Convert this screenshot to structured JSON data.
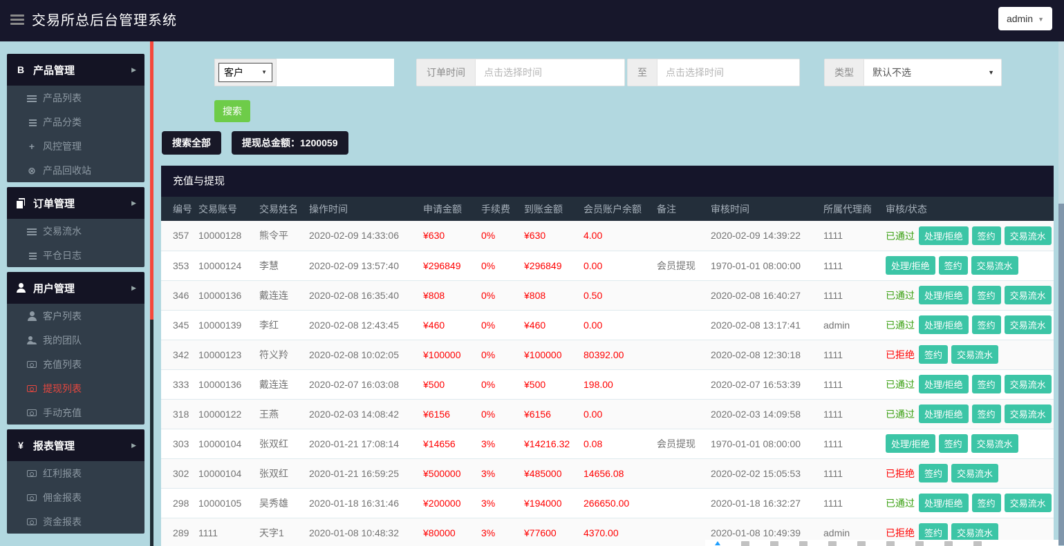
{
  "colors": {
    "header_bg": "#17172b",
    "panel_dark_bg": "#141424",
    "submenu_bg": "#313d49",
    "content_bg": "#b2d8e0",
    "sidebar_scroll_red": "#f5483b",
    "active_item_red": "#e8473f",
    "amount_red": "#ff0000",
    "pass_green": "#3aa012",
    "badge_teal": "#3cc5a6",
    "search_button_green": "#6ecc49",
    "table_header_bg": "#232e3a"
  },
  "header": {
    "title": "交易所总后台管理系统",
    "user_menu": "admin"
  },
  "sidebar": {
    "sections": [
      {
        "id": "product-management",
        "label": "产品管理",
        "icon": "bitcoin-icon",
        "items": [
          {
            "id": "product-list",
            "label": "产品列表",
            "icon": "list-icon",
            "active": false
          },
          {
            "id": "product-category",
            "label": "产品分类",
            "icon": "indent-list-icon",
            "active": false
          },
          {
            "id": "risk-control",
            "label": "风控管理",
            "icon": "move-icon",
            "active": false
          },
          {
            "id": "product-recycle",
            "label": "产品回收站",
            "icon": "cancel-circle-icon",
            "active": false
          }
        ]
      },
      {
        "id": "order-management",
        "label": "订单管理",
        "icon": "files-icon",
        "items": [
          {
            "id": "trade-flow",
            "label": "交易流水",
            "icon": "list-icon",
            "active": false
          },
          {
            "id": "close-log",
            "label": "平仓日志",
            "icon": "indent-list-icon",
            "active": false
          }
        ]
      },
      {
        "id": "user-management",
        "label": "用户管理",
        "icon": "user-icon",
        "items": [
          {
            "id": "customer-list",
            "label": "客户列表",
            "icon": "user-icon",
            "active": false
          },
          {
            "id": "my-team",
            "label": "我的团队",
            "icon": "team-icon",
            "active": false
          },
          {
            "id": "recharge-list",
            "label": "充值列表",
            "icon": "money-icon",
            "active": false
          },
          {
            "id": "withdraw-list",
            "label": "提现列表",
            "icon": "money-icon",
            "active": true
          },
          {
            "id": "manual-recharge",
            "label": "手动充值",
            "icon": "money-icon",
            "active": false
          }
        ]
      },
      {
        "id": "report-management",
        "label": "报表管理",
        "icon": "yen-icon",
        "items": [
          {
            "id": "bonus-report",
            "label": "红利报表",
            "icon": "money-icon",
            "active": false
          },
          {
            "id": "commission-report",
            "label": "佣金报表",
            "icon": "money-icon",
            "active": false
          },
          {
            "id": "fund-report",
            "label": "资金报表",
            "icon": "money-icon",
            "active": false
          }
        ]
      }
    ]
  },
  "filters": {
    "field_select": {
      "value": "客户"
    },
    "keyword_input": {
      "value": "",
      "placeholder": ""
    },
    "order_time_label": "订单时间",
    "date_from": {
      "value": "",
      "placeholder": "点击选择时间"
    },
    "to_label": "至",
    "date_to": {
      "value": "",
      "placeholder": "点击选择时间"
    },
    "type_label": "类型",
    "type_select": {
      "value": "默认不选"
    },
    "search_button": "搜索",
    "search_all_button": "搜索全部",
    "total_label": "提现总金额：1200059"
  },
  "table": {
    "title": "充值与提现",
    "columns": [
      "编号",
      "交易账号",
      "交易姓名",
      "操作时间",
      "申请金额",
      "手续费",
      "到账金额",
      "会员账户余额",
      "备注",
      "审核时间",
      "所属代理商",
      "审核/状态"
    ],
    "status_labels": {
      "pass": "已通过",
      "reject": "已拒绝"
    },
    "action_labels": {
      "handle": "处理/拒绝",
      "sign": "签约",
      "flow": "交易流水"
    },
    "rows": [
      {
        "id": "357",
        "account": "10000128",
        "name": "熊令平",
        "op_time": "2020-02-09 14:33:06",
        "apply": "¥630",
        "fee": "0%",
        "arrive": "¥630",
        "balance": "4.00",
        "remark": "",
        "audit_time": "2020-02-09 14:39:22",
        "agent": "1111",
        "status": "pass",
        "actions": [
          "handle",
          "sign",
          "flow"
        ]
      },
      {
        "id": "353",
        "account": "10000124",
        "name": "李慧",
        "op_time": "2020-02-09 13:57:40",
        "apply": "¥296849",
        "fee": "0%",
        "arrive": "¥296849",
        "balance": "0.00",
        "remark": "会员提现",
        "audit_time": "1970-01-01 08:00:00",
        "agent": "1111",
        "status": "",
        "actions": [
          "handle",
          "sign",
          "flow"
        ]
      },
      {
        "id": "346",
        "account": "10000136",
        "name": "戴连连",
        "op_time": "2020-02-08 16:35:40",
        "apply": "¥808",
        "fee": "0%",
        "arrive": "¥808",
        "balance": "0.50",
        "remark": "",
        "audit_time": "2020-02-08 16:40:27",
        "agent": "1111",
        "status": "pass",
        "actions": [
          "handle",
          "sign",
          "flow"
        ]
      },
      {
        "id": "345",
        "account": "10000139",
        "name": "李红",
        "op_time": "2020-02-08 12:43:45",
        "apply": "¥460",
        "fee": "0%",
        "arrive": "¥460",
        "balance": "0.00",
        "remark": "",
        "audit_time": "2020-02-08 13:17:41",
        "agent": "admin",
        "status": "pass",
        "actions": [
          "handle",
          "sign",
          "flow"
        ]
      },
      {
        "id": "342",
        "account": "10000123",
        "name": "符义羚",
        "op_time": "2020-02-08 10:02:05",
        "apply": "¥100000",
        "fee": "0%",
        "arrive": "¥100000",
        "balance": "80392.00",
        "remark": "",
        "audit_time": "2020-02-08 12:30:18",
        "agent": "1111",
        "status": "reject",
        "actions": [
          "sign",
          "flow"
        ]
      },
      {
        "id": "333",
        "account": "10000136",
        "name": "戴连连",
        "op_time": "2020-02-07 16:03:08",
        "apply": "¥500",
        "fee": "0%",
        "arrive": "¥500",
        "balance": "198.00",
        "remark": "",
        "audit_time": "2020-02-07 16:53:39",
        "agent": "1111",
        "status": "pass",
        "actions": [
          "handle",
          "sign",
          "flow"
        ]
      },
      {
        "id": "318",
        "account": "10000122",
        "name": "王燕",
        "op_time": "2020-02-03 14:08:42",
        "apply": "¥6156",
        "fee": "0%",
        "arrive": "¥6156",
        "balance": "0.00",
        "remark": "",
        "audit_time": "2020-02-03 14:09:58",
        "agent": "1111",
        "status": "pass",
        "actions": [
          "handle",
          "sign",
          "flow"
        ]
      },
      {
        "id": "303",
        "account": "10000104",
        "name": "张双红",
        "op_time": "2020-01-21 17:08:14",
        "apply": "¥14656",
        "fee": "3%",
        "arrive": "¥14216.32",
        "balance": "0.08",
        "remark": "会员提现",
        "audit_time": "1970-01-01 08:00:00",
        "agent": "1111",
        "status": "",
        "actions": [
          "handle",
          "sign",
          "flow"
        ]
      },
      {
        "id": "302",
        "account": "10000104",
        "name": "张双红",
        "op_time": "2020-01-21 16:59:25",
        "apply": "¥500000",
        "fee": "3%",
        "arrive": "¥485000",
        "balance": "14656.08",
        "remark": "",
        "audit_time": "2020-02-02 15:05:53",
        "agent": "1111",
        "status": "reject",
        "actions": [
          "sign",
          "flow"
        ]
      },
      {
        "id": "298",
        "account": "10000105",
        "name": "吴秀雄",
        "op_time": "2020-01-18 16:31:46",
        "apply": "¥200000",
        "fee": "3%",
        "arrive": "¥194000",
        "balance": "266650.00",
        "remark": "",
        "audit_time": "2020-01-18 16:32:27",
        "agent": "1111",
        "status": "pass",
        "actions": [
          "handle",
          "sign",
          "flow"
        ]
      },
      {
        "id": "289",
        "account": "1111",
        "name": "天字1",
        "op_time": "2020-01-08 10:48:32",
        "apply": "¥80000",
        "fee": "3%",
        "arrive": "¥77600",
        "balance": "4370.00",
        "remark": "",
        "audit_time": "2020-01-08 10:49:39",
        "agent": "admin",
        "status": "reject",
        "actions": [
          "sign",
          "flow"
        ]
      }
    ]
  }
}
